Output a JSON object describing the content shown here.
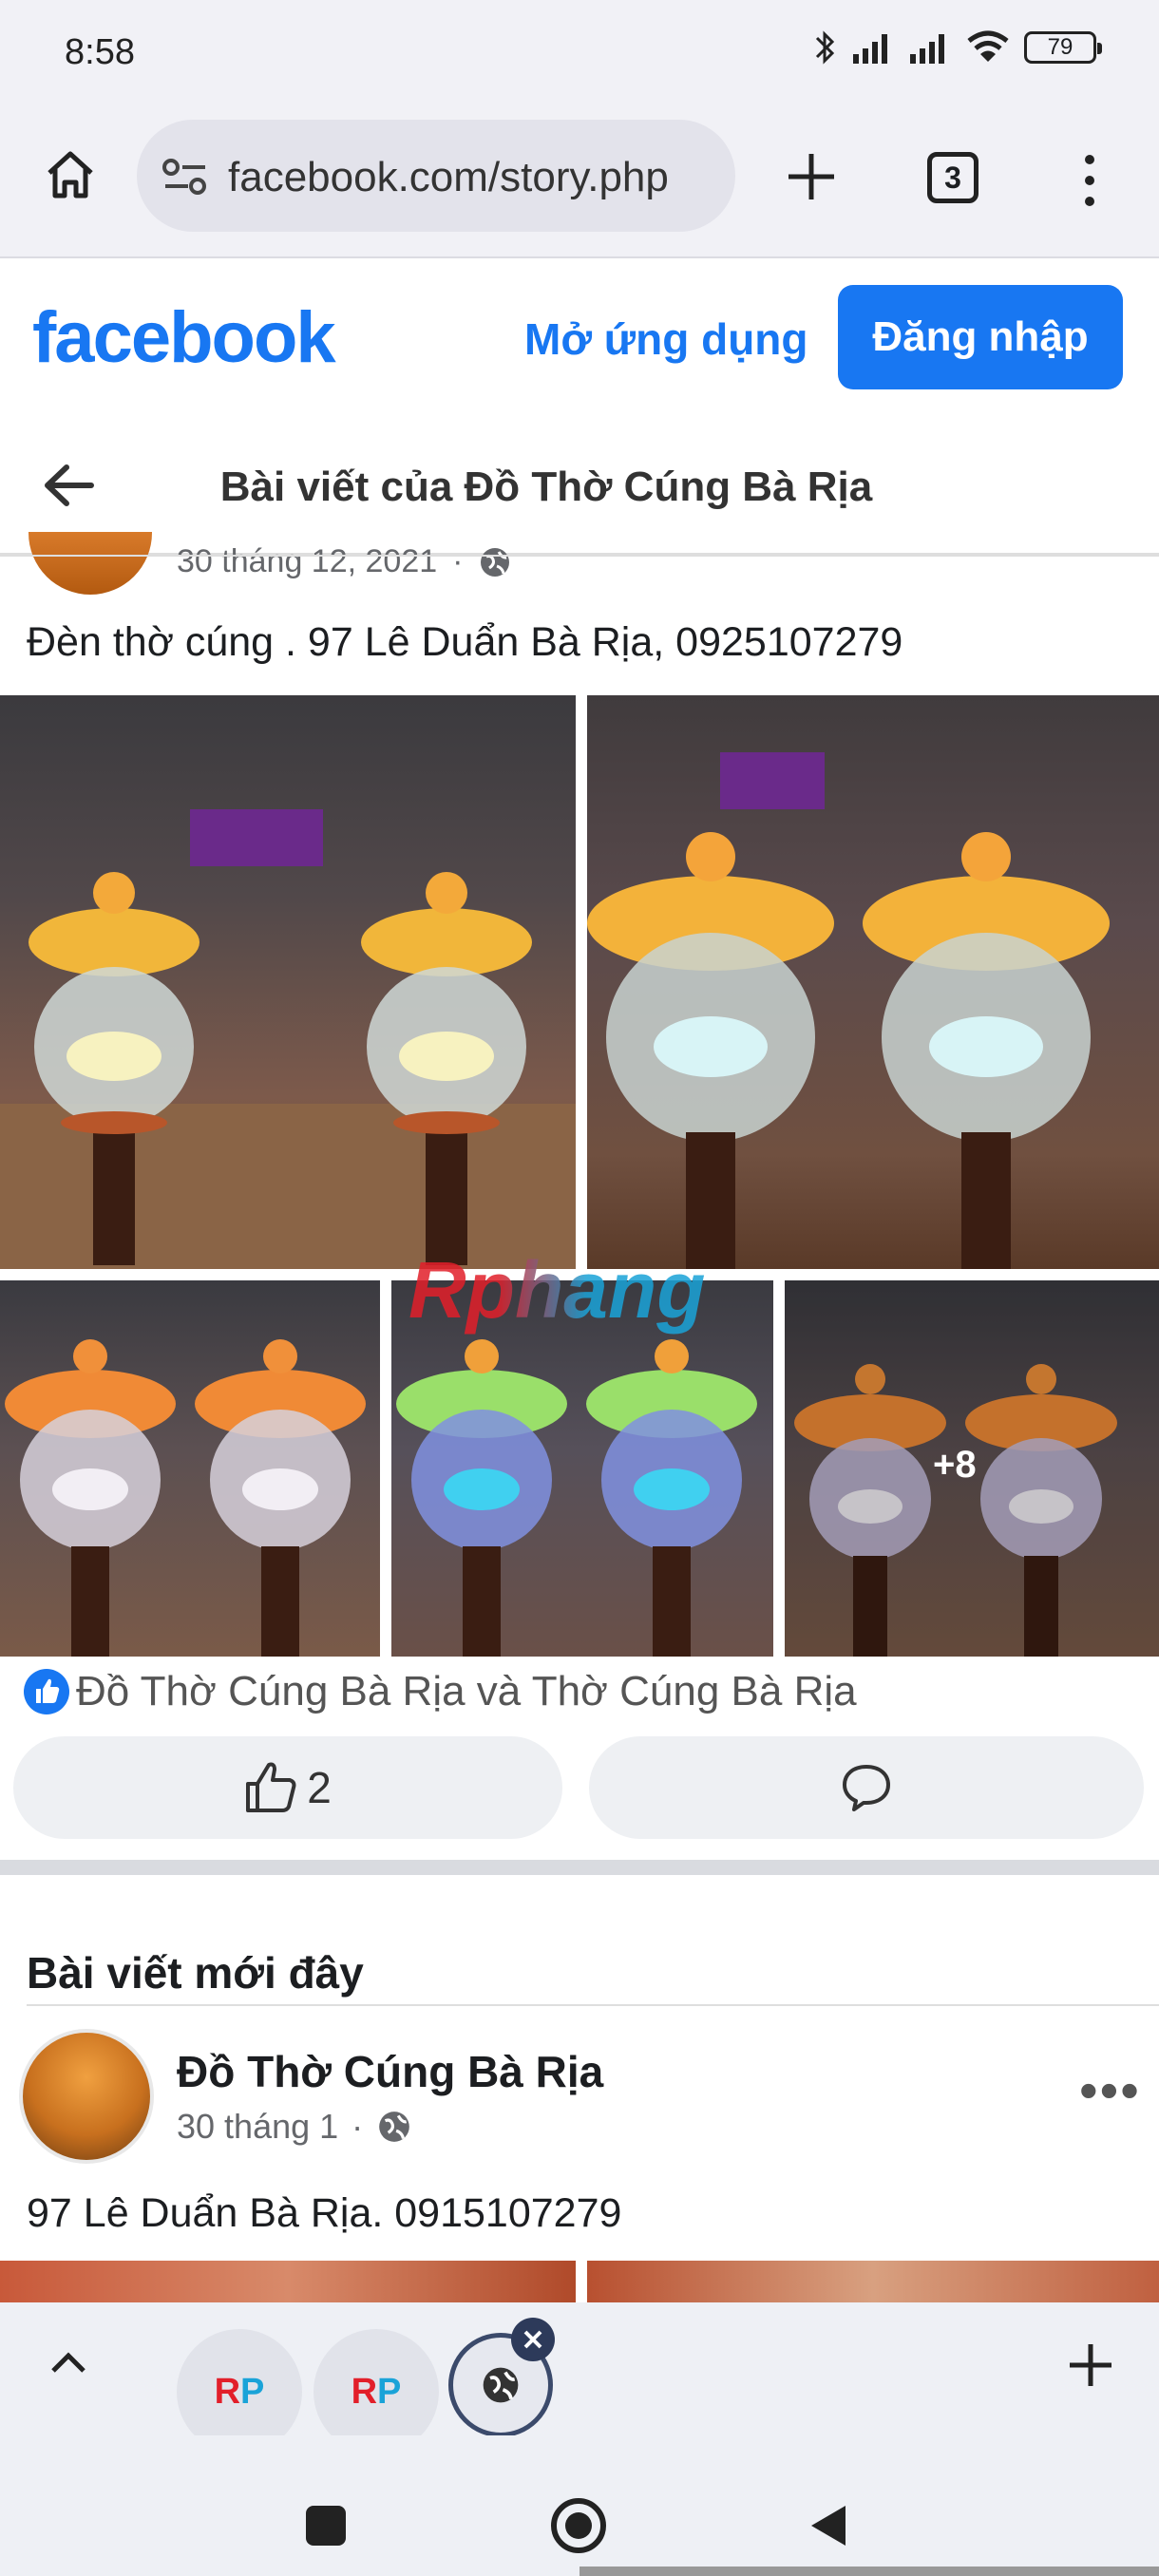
{
  "status_bar": {
    "time": "8:58",
    "battery": "79"
  },
  "browser": {
    "url": "facebook.com/story.php",
    "tab_count": "3"
  },
  "fb_header": {
    "logo": "facebook",
    "open_app": "Mở ứng dụng",
    "login": "Đăng nhập"
  },
  "page_title": "Bài viết của Đồ Thờ Cúng Bà Rịa",
  "post": {
    "date": "30 tháng 12, 2021",
    "caption": "Đèn thờ cúng . 97 Lê Duẩn Bà Rịa, 0925107279",
    "more_photos": "+8",
    "watermark": "Rphang",
    "reactors": "Đồ Thờ Cúng Bà Rịa và Thờ Cúng Bà Rịa",
    "like_count": "2"
  },
  "recent": {
    "section_title": "Bài viết mới đây",
    "page_name": "Đồ Thờ Cúng Bà Rịa",
    "date": "30 tháng 1",
    "caption": "97 Lê Duẩn Bà Rịa. 0915107279"
  },
  "tabs": {
    "tab1_label": "RP",
    "tab2_label": "RP"
  },
  "colors": {
    "fb_blue": "#1877f2",
    "browser_bg": "#f1f1f6"
  }
}
